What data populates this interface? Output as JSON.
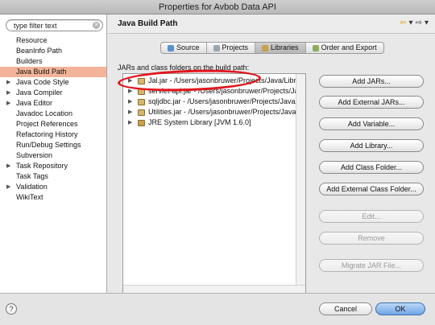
{
  "window": {
    "title": "Properties for Avbob Data API"
  },
  "filter": {
    "placeholder": "type filter text",
    "value": "type filter text"
  },
  "sidebar": {
    "items": [
      {
        "label": "Resource",
        "expandable": false
      },
      {
        "label": "BeanInfo Path",
        "expandable": false
      },
      {
        "label": "Builders",
        "expandable": false
      },
      {
        "label": "Java Build Path",
        "expandable": false,
        "selected": true
      },
      {
        "label": "Java Code Style",
        "expandable": true
      },
      {
        "label": "Java Compiler",
        "expandable": true
      },
      {
        "label": "Java Editor",
        "expandable": true
      },
      {
        "label": "Javadoc Location",
        "expandable": false
      },
      {
        "label": "Project References",
        "expandable": false
      },
      {
        "label": "Refactoring History",
        "expandable": false
      },
      {
        "label": "Run/Debug Settings",
        "expandable": false
      },
      {
        "label": "Subversion",
        "expandable": false
      },
      {
        "label": "Task Repository",
        "expandable": true
      },
      {
        "label": "Task Tags",
        "expandable": false
      },
      {
        "label": "Validation",
        "expandable": true
      },
      {
        "label": "WikiText",
        "expandable": false
      }
    ]
  },
  "header": {
    "title": "Java Build Path"
  },
  "tabs": [
    {
      "label": "Source",
      "active": false,
      "color": "#5a8fd0"
    },
    {
      "label": "Projects",
      "active": false,
      "color": "#9aa4b4"
    },
    {
      "label": "Libraries",
      "active": true,
      "color": "#c9a04b"
    },
    {
      "label": "Order and Export",
      "active": false,
      "color": "#8cae5e"
    }
  ],
  "libraries": {
    "label": "JARs and class folders on the build path:",
    "entries": [
      "Jal.jar - /Users/jasonbruwer/Projects/Java/Libra",
      "servlet-api.jar - /Users/jasonbruwer/Projects/Java/",
      "sqljdbc.jar - /Users/jasonbruwer/Projects/Java/",
      "Utilities.jar - /Users/jasonbruwer/Projects/Java/",
      "JRE System Library [JVM 1.6.0]"
    ],
    "highlight_color": "#e2141b"
  },
  "buttons": {
    "add_jars": "Add JARs...",
    "add_external_jars": "Add External JARs...",
    "add_variable": "Add Variable...",
    "add_library": "Add Library...",
    "add_class_folder": "Add Class Folder...",
    "add_external_class_folder": "Add External Class Folder...",
    "edit": "Edit...",
    "remove": "Remove",
    "migrate": "Migrate JAR File...",
    "cancel": "Cancel",
    "ok": "OK",
    "help": "?"
  }
}
